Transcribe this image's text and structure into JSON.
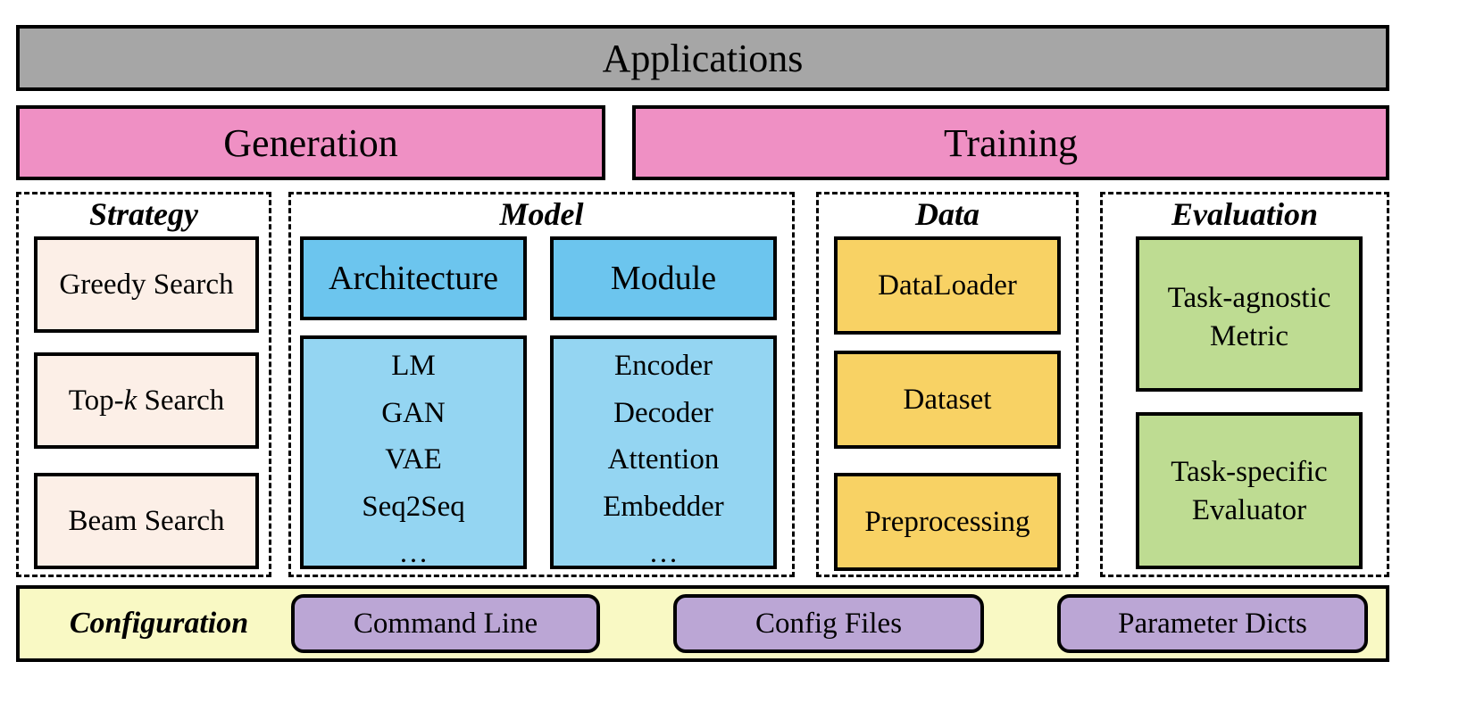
{
  "diagram": {
    "applications": {
      "label": "Applications",
      "color": "#a6a6a6"
    },
    "top_modules": [
      {
        "label": "Generation",
        "color": "#ef90c4"
      },
      {
        "label": "Training",
        "color": "#ef90c4"
      }
    ],
    "groups": {
      "strategy": {
        "title": "Strategy",
        "items": [
          {
            "label": "Greedy Search"
          },
          {
            "prefix": "Top-",
            "italic": "k",
            "suffix": " Search"
          },
          {
            "label": "Beam Search"
          }
        ],
        "color": "#fcefe7"
      },
      "model": {
        "title": "Model",
        "columns": [
          {
            "header": "Architecture",
            "items": [
              "LM",
              "GAN",
              "VAE",
              "Seq2Seq",
              "…"
            ]
          },
          {
            "header": "Module",
            "items": [
              "Encoder",
              "Decoder",
              "Attention",
              "Embedder",
              "…"
            ]
          }
        ],
        "header_color": "#6cc5ee",
        "list_color": "#94d5f2"
      },
      "data": {
        "title": "Data",
        "items": [
          "DataLoader",
          "Dataset",
          "Preprocessing"
        ],
        "color": "#f8d264"
      },
      "evaluation": {
        "title": "Evaluation",
        "items": [
          {
            "line1": "Task-agnostic",
            "line2": "Metric"
          },
          {
            "line1": "Task-specific",
            "line2": "Evaluator"
          }
        ],
        "color": "#bedc92"
      }
    },
    "configuration": {
      "label": "Configuration",
      "items": [
        "Command Line",
        "Config Files",
        "Parameter Dicts"
      ],
      "color": "#f9f9c4",
      "item_color": "#bba6d5"
    }
  }
}
